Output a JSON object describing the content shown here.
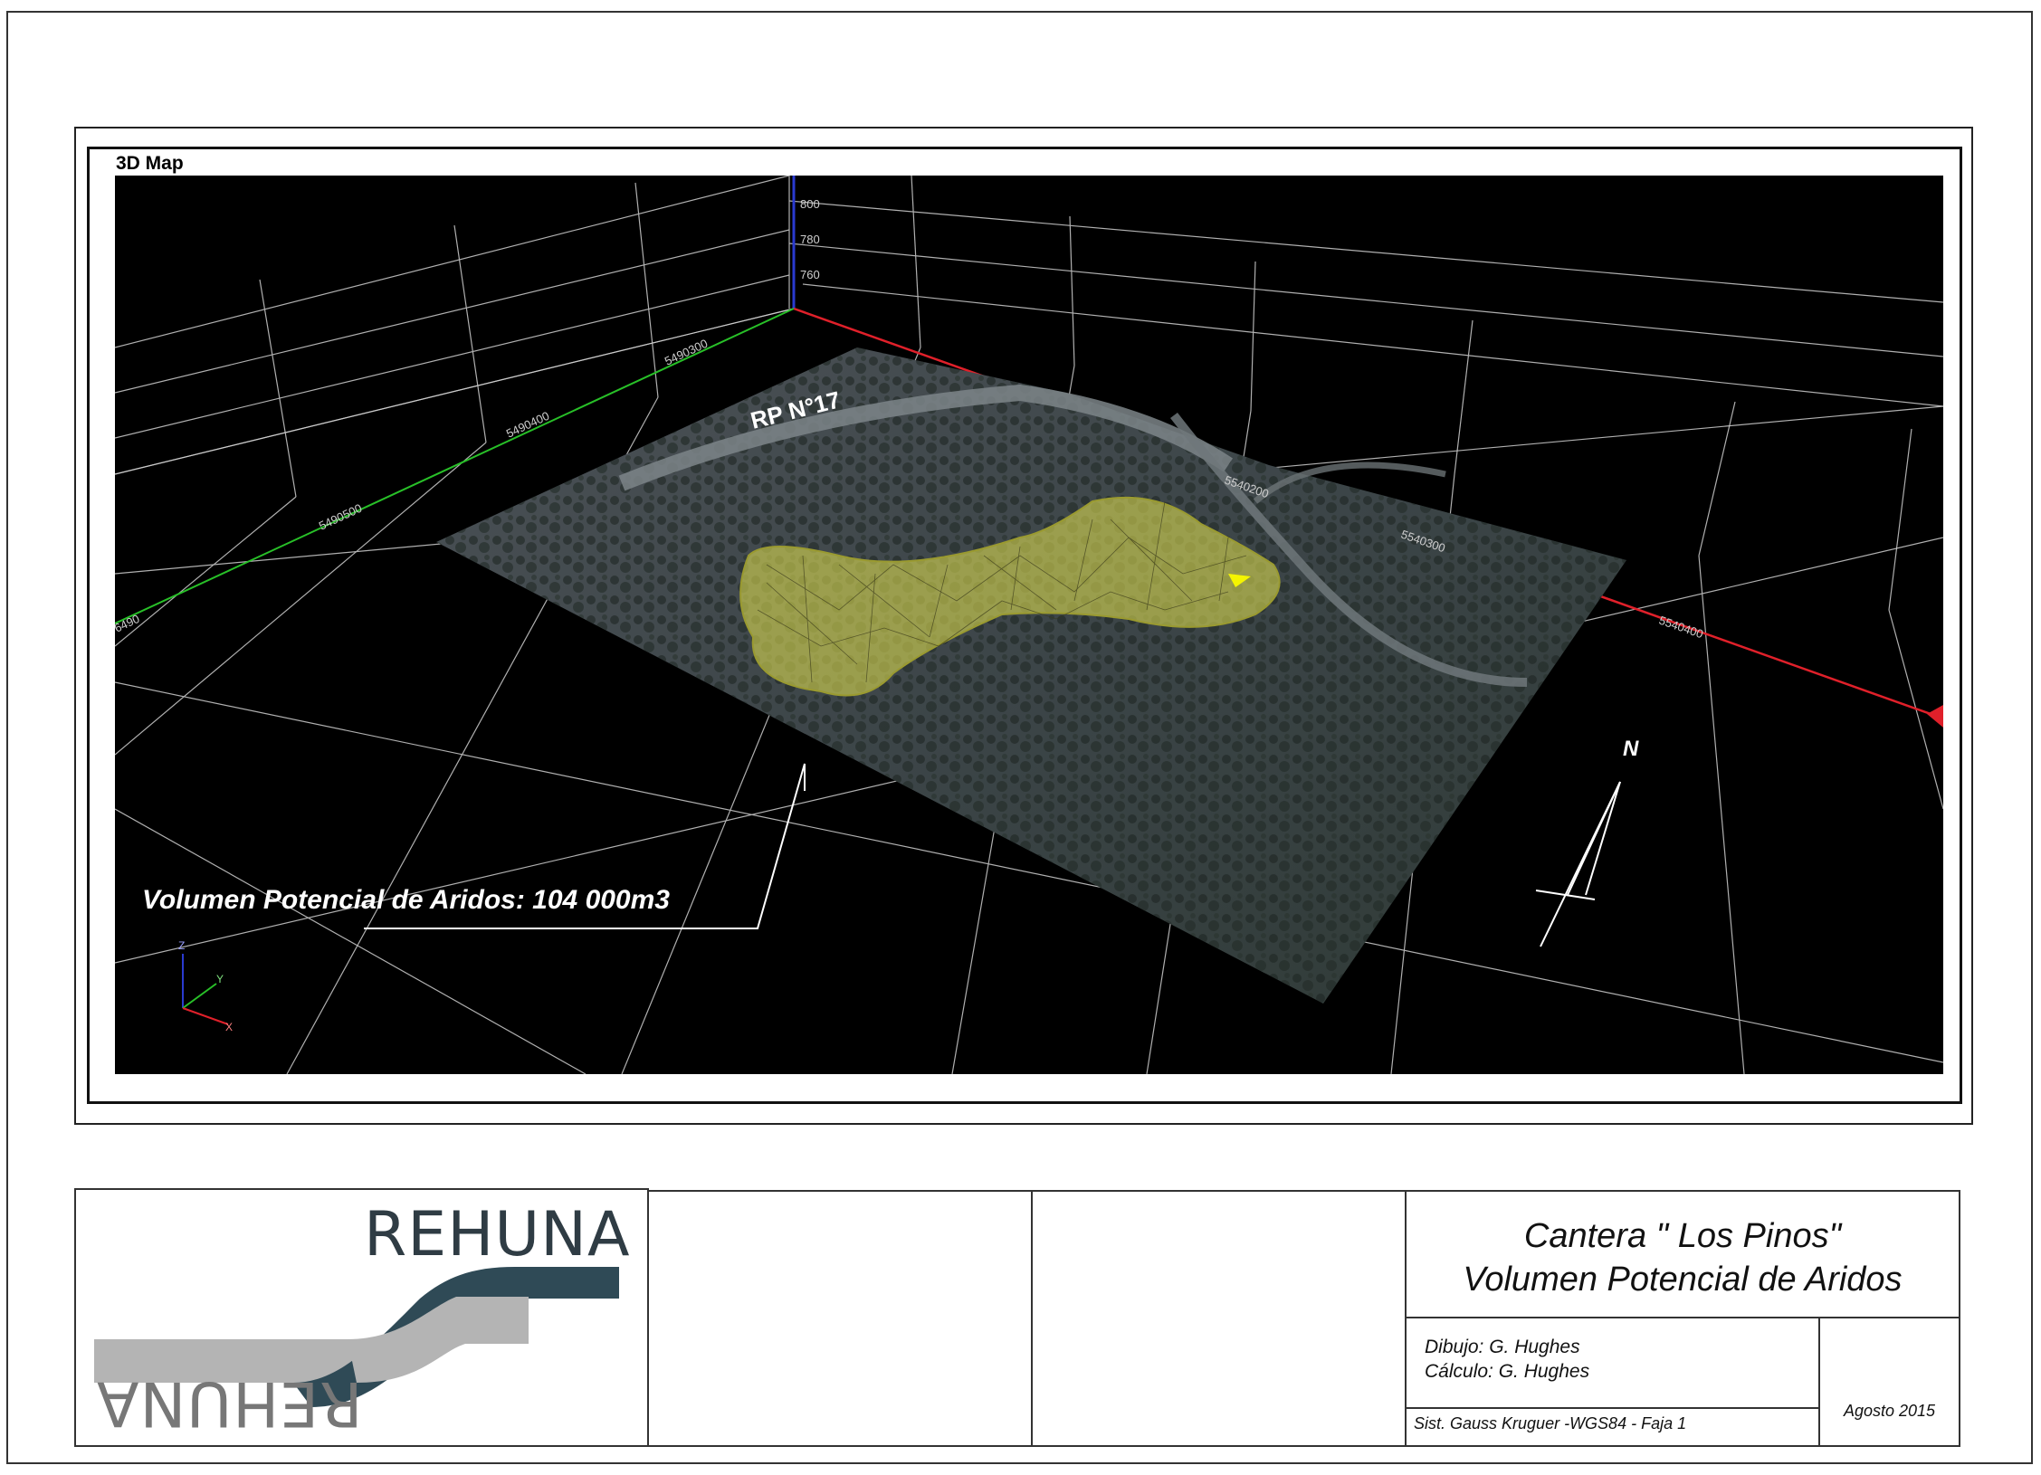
{
  "map": {
    "panel_title": "3D Map",
    "road_label": "RP N°17",
    "volume_label": "Volumen Potencial de Aridos: 104 000m3",
    "north_label": "N",
    "z_ticks": [
      "800",
      "780",
      "760"
    ],
    "x_ticks": [
      "5540200",
      "5540300",
      "5540400"
    ],
    "y_ticks": [
      "6490",
      "5490500",
      "5490400",
      "5490300"
    ],
    "axis_triad": {
      "x": "X",
      "y": "Y",
      "z": "Z"
    },
    "colors": {
      "background": "#000000",
      "grid": "#cfcfcf",
      "x_axis": "#e0202a",
      "y_axis": "#28c028",
      "z_axis": "#2a3ad0",
      "deposit": "#d8d850"
    }
  },
  "title_block": {
    "logo_text": "REHUNA",
    "project_title_line1": "Cantera \" Los Pinos\"",
    "project_title_line2": "Volumen Potencial de Aridos",
    "drawn_by": "Dibujo: G. Hughes",
    "calculated_by": "Cálculo: G. Hughes",
    "datum": "Sist. Gauss Kruguer -WGS84 - Faja 1",
    "date": "Agosto 2015",
    "logo_colors": {
      "dark": "#2f4a56",
      "grey": "#b4b4b4"
    }
  }
}
